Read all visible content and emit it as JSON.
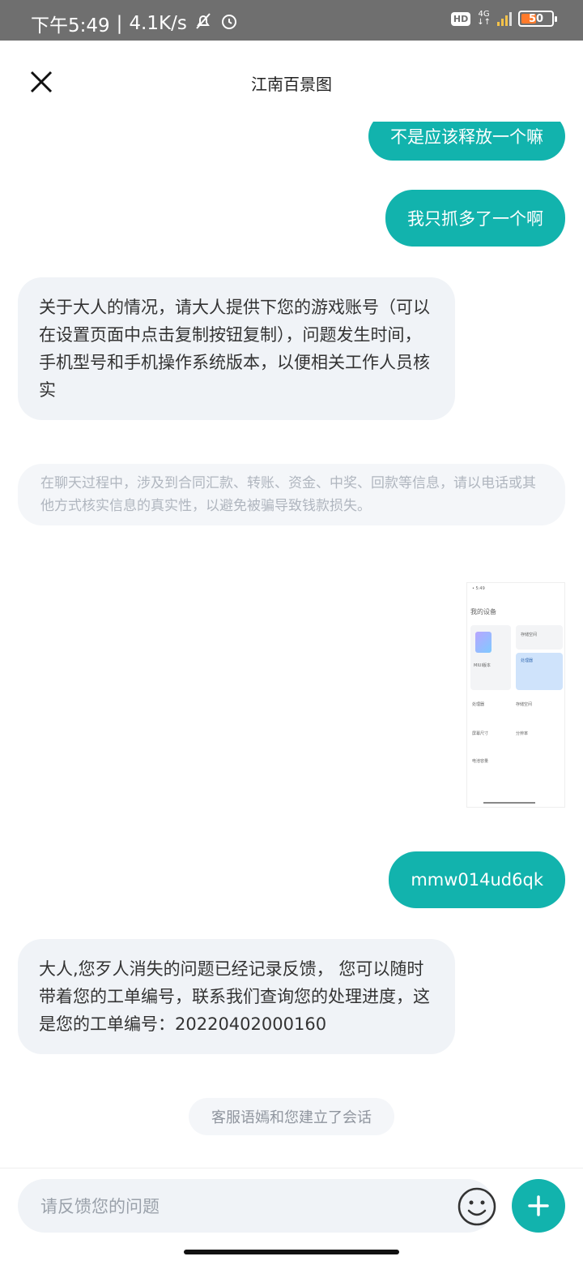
{
  "status_bar": {
    "time": "下午5:49",
    "net_speed": "4.1K/s",
    "hd": "HD",
    "network": "4G",
    "battery": "50",
    "colors": {
      "bg": "#6f6f6f",
      "battery_fill": "#ff7a2b",
      "signal": "#f3c24a"
    }
  },
  "header": {
    "title": "江南百景图",
    "close_icon": "close-icon"
  },
  "messages": {
    "m1": "不是应该释放一个嘛",
    "m2": "我只抓多了一个啊",
    "m3": "关于大人的情况，请大人提供下您的游戏账号（可以在设置页面中点击复制按钮复制），问题发生时间，手机型号和手机操作系统版本，以便相关工作人员核实",
    "notice": "在聊天过程中，涉及到合同汇款、转账、资金、中奖、回款等信息，请以电话或其他方式核实信息的真实性，以避免被骗导致钱款损失。",
    "m5": "mmw014ud6qk",
    "m6": "大人,您歹人消失的问题已经记录反馈， 您可以随时带着您的工单编号，联系我们查询您的处理进度，这是您的工单编号：20220402000160",
    "session": "客服语嫣和您建立了会话"
  },
  "screenshot_thumb": {
    "header": "我的设备",
    "miui": "MIUI版本",
    "storage": "存储空间",
    "cpu": "处理器",
    "battery": "电池容量",
    "screen": "屏幕尺寸",
    "resolution": "分辨率"
  },
  "input": {
    "placeholder": "请反馈您的问题",
    "emoji_icon": "smiley-icon",
    "plus_icon": "plus-icon"
  },
  "colors": {
    "accent": "#12b3ad",
    "bubble_in": "#f0f3f7"
  }
}
